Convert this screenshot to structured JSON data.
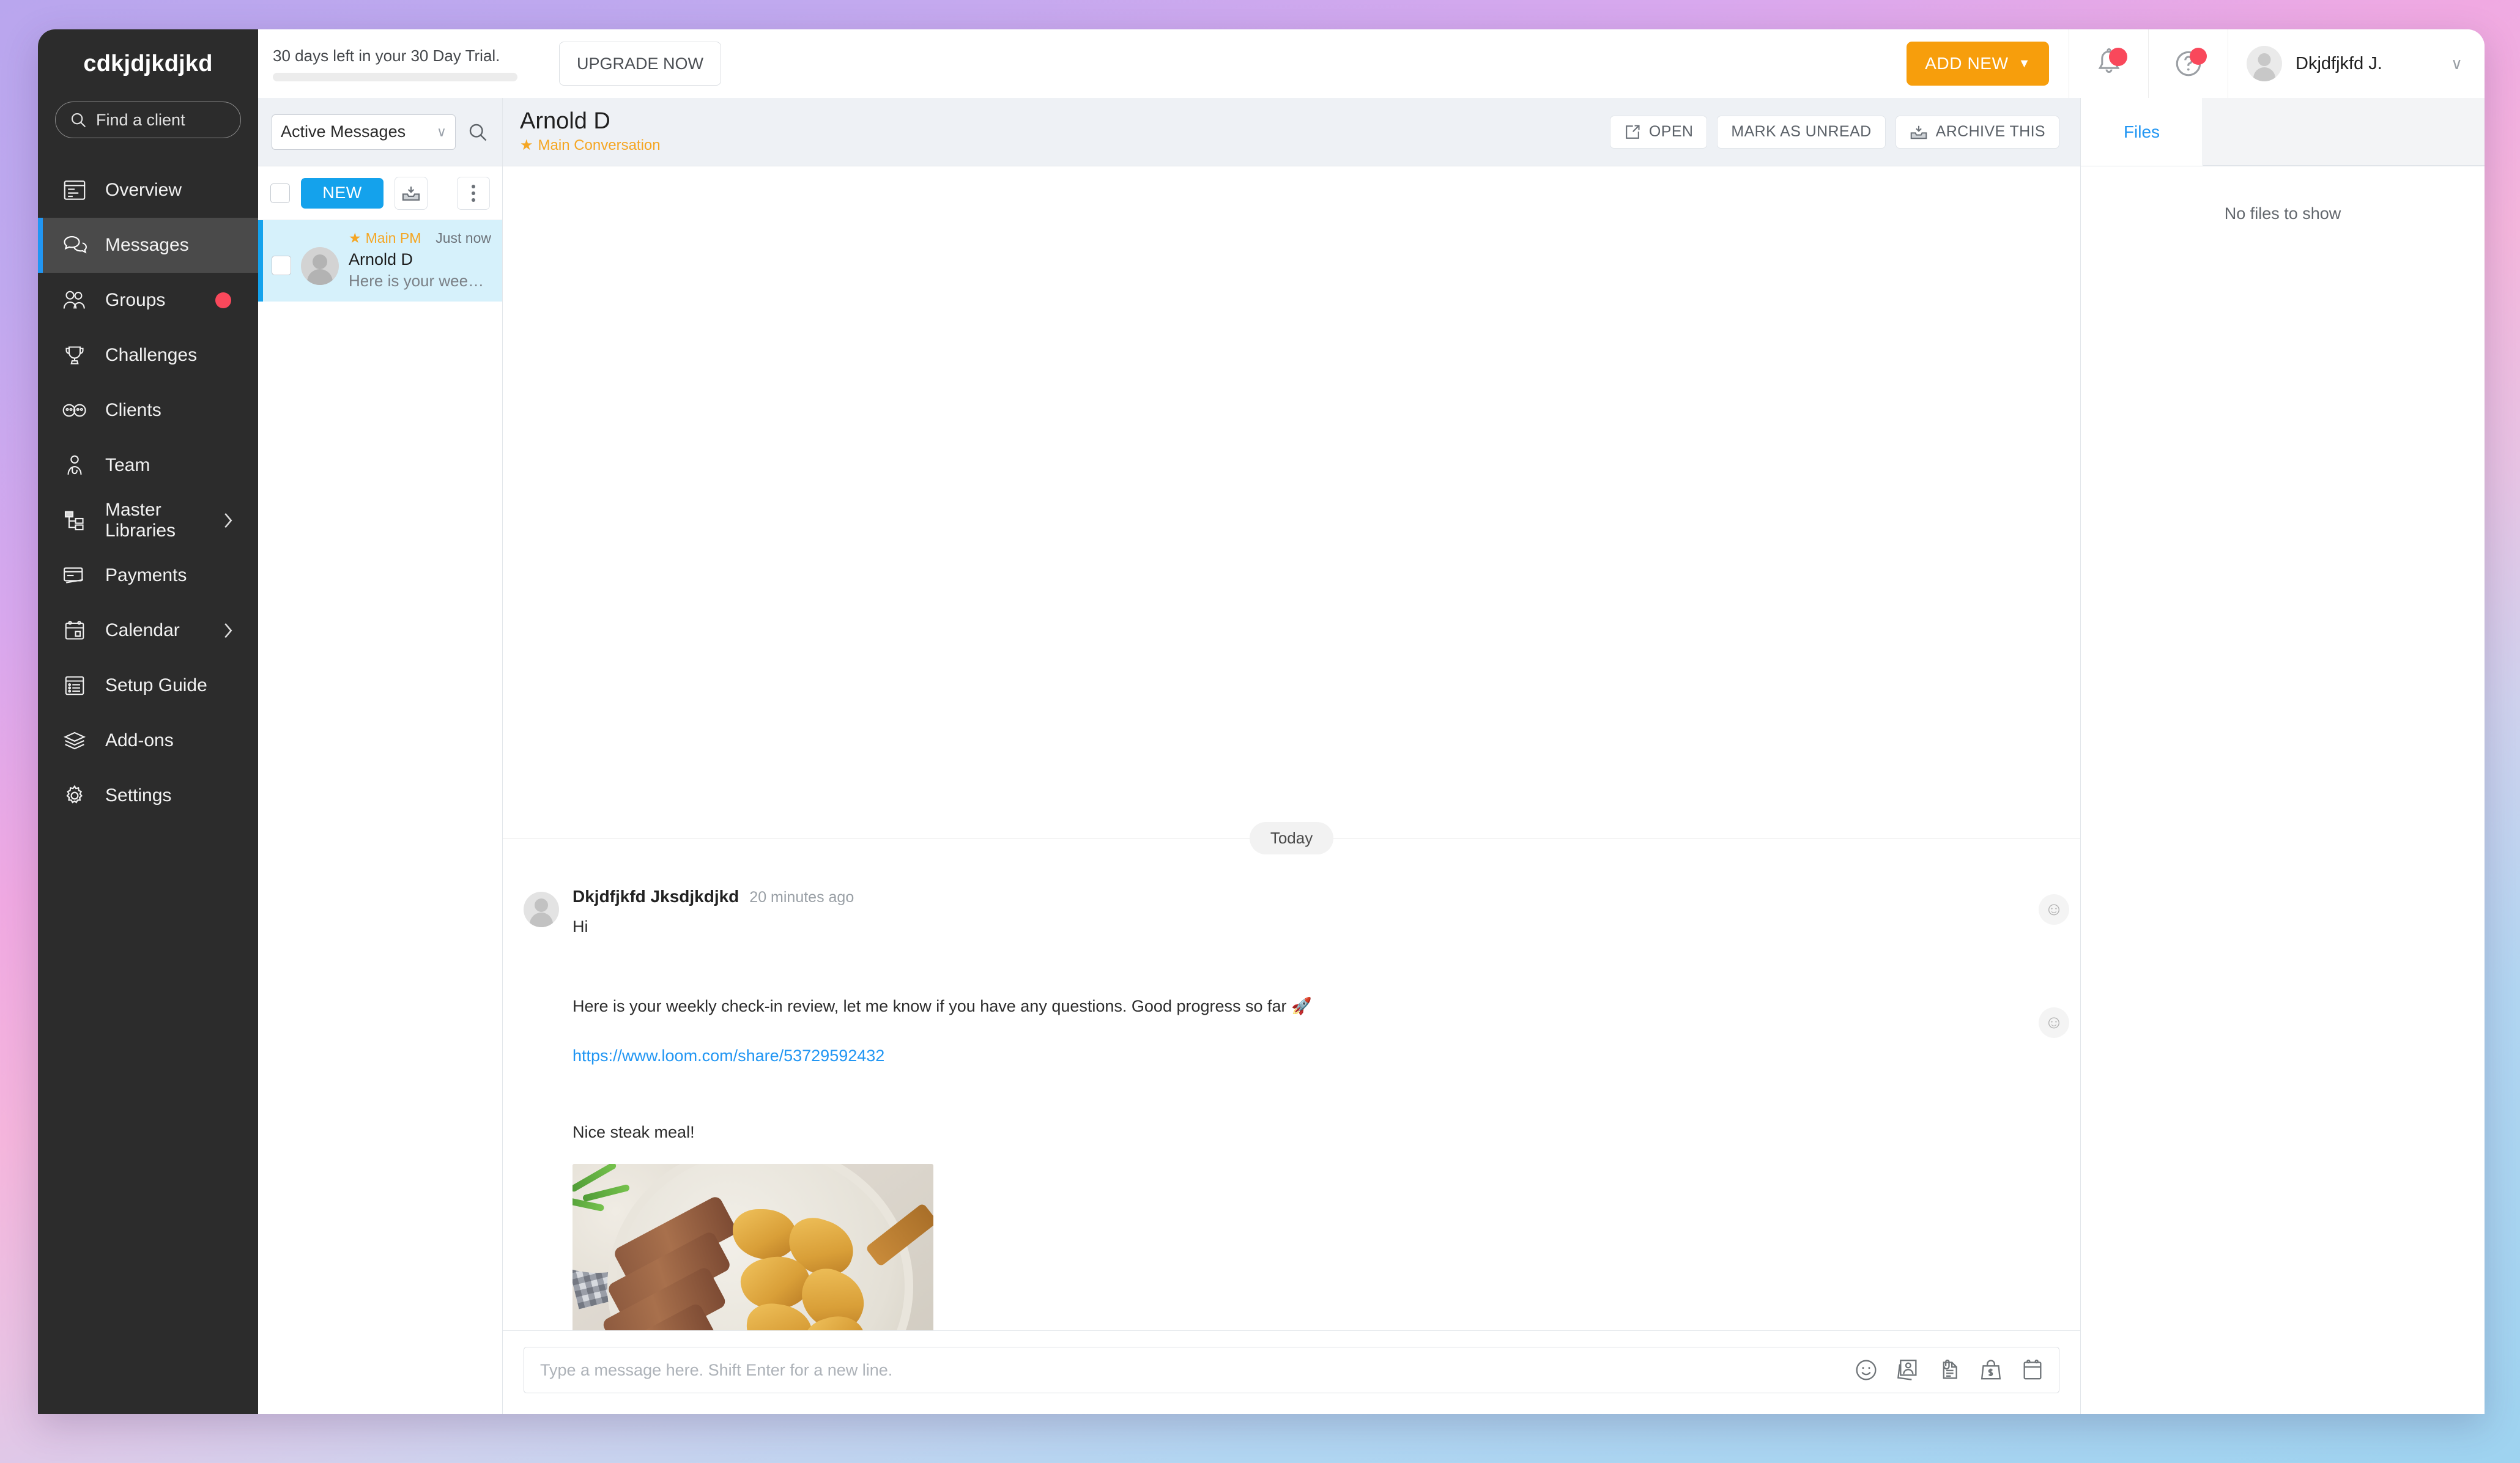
{
  "brand": {
    "name": "cdkjdjkdjkd"
  },
  "sidebar": {
    "search_placeholder": "Find a client",
    "items": [
      {
        "label": "Overview",
        "icon": "overview-icon"
      },
      {
        "label": "Messages",
        "icon": "messages-icon"
      },
      {
        "label": "Groups",
        "icon": "groups-icon"
      },
      {
        "label": "Challenges",
        "icon": "trophy-icon"
      },
      {
        "label": "Clients",
        "icon": "clients-icon"
      },
      {
        "label": "Team",
        "icon": "team-icon"
      },
      {
        "label": "Master Libraries",
        "icon": "library-icon"
      },
      {
        "label": "Payments",
        "icon": "card-icon"
      },
      {
        "label": "Calendar",
        "icon": "calendar-icon"
      },
      {
        "label": "Setup Guide",
        "icon": "list-icon"
      },
      {
        "label": "Add-ons",
        "icon": "layers-icon"
      },
      {
        "label": "Settings",
        "icon": "gear-icon"
      }
    ]
  },
  "topbar": {
    "trial_text": "30 days left in your 30 Day Trial.",
    "upgrade_label": "UPGRADE NOW",
    "add_new_label": "ADD NEW",
    "add_new_caret": "▼",
    "user_name": "Dkjdfjkfd J.",
    "user_caret": "∨"
  },
  "list_panel": {
    "filter_value": "Active Messages",
    "filter_caret": "∨",
    "new_label": "NEW",
    "conversations": [
      {
        "tag": "Main PM",
        "time": "Just now",
        "name": "Arnold D",
        "preview": "Here is your week…"
      }
    ]
  },
  "conversation": {
    "title": "Arnold D",
    "subtitle": "Main Conversation",
    "star": "★",
    "actions": [
      {
        "label": "OPEN",
        "icon": "open-external-icon"
      },
      {
        "label": "MARK AS UNREAD",
        "icon": "none"
      },
      {
        "label": "ARCHIVE THIS",
        "icon": "archive-icon"
      }
    ],
    "day_separator": "Today",
    "message": {
      "author": "Dkjdfjkfd Jksdjkdjkd",
      "time": "20 minutes ago",
      "line1": "Hi",
      "line2": "Here is your weekly check-in review, let me know if you have any questions. Good progress so far 🚀",
      "link": "https://www.loom.com/share/53729592432",
      "line3": "Nice steak meal!",
      "image_alt": "steak-meal-photo"
    },
    "reaction_icon": "☺"
  },
  "composer": {
    "placeholder": "Type a message here. Shift Enter for a new line.",
    "tools": [
      {
        "name": "emoji-icon"
      },
      {
        "name": "image-icon"
      },
      {
        "name": "attachment-icon"
      },
      {
        "name": "product-icon"
      },
      {
        "name": "calendar-icon"
      }
    ]
  },
  "files_panel": {
    "tab_label": "Files",
    "empty_text": "No files to show"
  },
  "colors": {
    "accent_blue": "#14a2ec",
    "accent_orange": "#f5a623",
    "badge_red": "#f9485b",
    "sidebar_bg": "#2c2c2c"
  }
}
